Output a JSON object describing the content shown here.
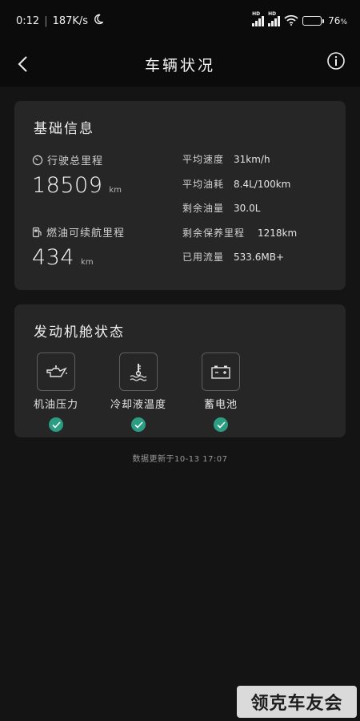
{
  "status_bar": {
    "time": "0:12",
    "net_speed": "187K/s",
    "battery_percent": "76",
    "battery_suffix": "%",
    "signal_label": "HD"
  },
  "header": {
    "title": "车辆状况"
  },
  "basic_info": {
    "title": "基础信息",
    "total_mileage": {
      "label": "行驶总里程",
      "value": "18509",
      "unit": "km"
    },
    "fuel_range": {
      "label": "燃油可续航里程",
      "value": "434",
      "unit": "km"
    },
    "details": [
      {
        "label": "平均速度",
        "value": "31km/h"
      },
      {
        "label": "平均油耗",
        "value": "8.4L/100km"
      },
      {
        "label": "剩余油量",
        "value": "30.0L"
      },
      {
        "label": "剩余保养里程",
        "value": "1218km"
      },
      {
        "label": "已用流量",
        "value": "533.6MB+"
      }
    ]
  },
  "engine": {
    "title": "发动机舱状态",
    "items": [
      {
        "label": "机油压力",
        "icon": "oil-can-icon",
        "status": "normal"
      },
      {
        "label": "冷却液温度",
        "icon": "coolant-temp-icon",
        "status": "normal"
      },
      {
        "label": "蓄电池",
        "icon": "battery-icon",
        "status": "normal"
      }
    ]
  },
  "update_note": "数据更新于10-13 17:07",
  "watermark": "领克车友会",
  "colors": {
    "background": "#141414",
    "card": "#262626",
    "status_ok": "#2a9d83"
  }
}
